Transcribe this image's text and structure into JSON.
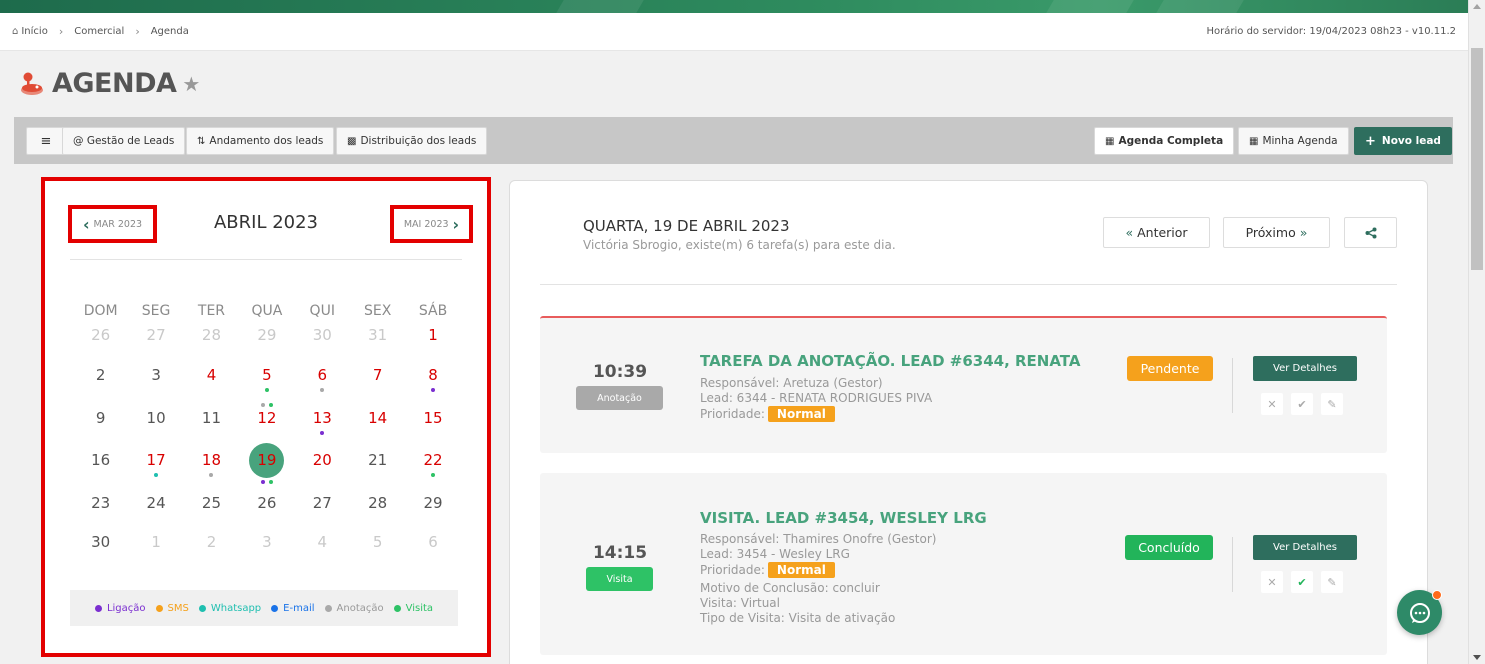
{
  "breadcrumb": {
    "home": "Início",
    "commercial": "Comercial",
    "agenda": "Agenda"
  },
  "server_time": "Horário do servidor: 19/04/2023 08h23 - v10.11.2",
  "page": {
    "title": "AGENDA"
  },
  "toolbar": {
    "leads_management": "@ Gestão de Leads",
    "leads_progress": "Andamento dos leads",
    "leads_distribution": "Distribuição dos leads",
    "full_agenda": "Agenda Completa",
    "my_agenda": "Minha Agenda",
    "new_lead": "Novo lead"
  },
  "calendar": {
    "prev": "MAR 2023",
    "next": "MAI 2023",
    "month": "ABRIL 2023",
    "weekdays": [
      "DOM",
      "SEG",
      "TER",
      "QUA",
      "QUI",
      "SEX",
      "SÁB"
    ],
    "weeks": [
      [
        {
          "d": "26",
          "t": "muted"
        },
        {
          "d": "27",
          "t": "muted"
        },
        {
          "d": "28",
          "t": "muted"
        },
        {
          "d": "29",
          "t": "muted"
        },
        {
          "d": "30",
          "t": "muted"
        },
        {
          "d": "31",
          "t": "muted"
        },
        {
          "d": "1",
          "t": "red"
        }
      ],
      [
        {
          "d": "2",
          "t": ""
        },
        {
          "d": "3",
          "t": ""
        },
        {
          "d": "4",
          "t": "red"
        },
        {
          "d": "5",
          "t": "red",
          "dots": [
            "visita"
          ]
        },
        {
          "d": "6",
          "t": "red",
          "dots": [
            "anotacao"
          ]
        },
        {
          "d": "7",
          "t": "red"
        },
        {
          "d": "8",
          "t": "red",
          "dots": [
            "ligacao"
          ]
        }
      ],
      [
        {
          "d": "9",
          "t": ""
        },
        {
          "d": "10",
          "t": ""
        },
        {
          "d": "11",
          "t": ""
        },
        {
          "d": "12",
          "t": "red",
          "dots": [
            "anotacao",
            "visita"
          ]
        },
        {
          "d": "13",
          "t": "red",
          "dots": [
            "ligacao"
          ]
        },
        {
          "d": "14",
          "t": "red"
        },
        {
          "d": "15",
          "t": "red"
        }
      ],
      [
        {
          "d": "16",
          "t": ""
        },
        {
          "d": "17",
          "t": "red",
          "dots": [
            "whatsapp"
          ]
        },
        {
          "d": "18",
          "t": "red",
          "dots": [
            "anotacao"
          ]
        },
        {
          "d": "19",
          "t": "today",
          "dots": [
            "ligacao",
            "visita"
          ]
        },
        {
          "d": "20",
          "t": "red"
        },
        {
          "d": "21",
          "t": ""
        },
        {
          "d": "22",
          "t": "red",
          "dots": [
            "visita"
          ]
        }
      ],
      [
        {
          "d": "23",
          "t": ""
        },
        {
          "d": "24",
          "t": ""
        },
        {
          "d": "25",
          "t": ""
        },
        {
          "d": "26",
          "t": ""
        },
        {
          "d": "27",
          "t": ""
        },
        {
          "d": "28",
          "t": ""
        },
        {
          "d": "29",
          "t": ""
        }
      ],
      [
        {
          "d": "30",
          "t": ""
        },
        {
          "d": "1",
          "t": "muted"
        },
        {
          "d": "2",
          "t": "muted"
        },
        {
          "d": "3",
          "t": "muted"
        },
        {
          "d": "4",
          "t": "muted"
        },
        {
          "d": "5",
          "t": "muted"
        },
        {
          "d": "6",
          "t": "muted"
        }
      ]
    ],
    "legend": [
      {
        "label": "Ligação",
        "key": "ligacao",
        "color": "#7b2fd0"
      },
      {
        "label": "SMS",
        "key": "sms",
        "color": "#f5a11c"
      },
      {
        "label": "Whatsapp",
        "key": "whatsapp",
        "color": "#1fbfb0"
      },
      {
        "label": "E-mail",
        "key": "email",
        "color": "#1a73e8"
      },
      {
        "label": "Anotação",
        "key": "anotacao",
        "color": "#a9a9a9"
      },
      {
        "label": "Visita",
        "key": "visita",
        "color": "#2ec266"
      }
    ]
  },
  "day_view": {
    "title": "QUARTA, 19 DE ABRIL 2023",
    "subtitle": "Victória Sbrogio, existe(m) 6 tarefa(s) para este dia.",
    "prev_label": "Anterior",
    "next_label": "Próximo"
  },
  "tasks": [
    {
      "time": "10:39",
      "type": "Anotação",
      "type_color": "#a9a9a9",
      "title": "TAREFA DA ANOTAÇÃO. LEAD #6344, RENATA",
      "lines": [
        "Responsável: Aretuza (Gestor)",
        "Lead: 6344 - RENATA RODRIGUES PIVA"
      ],
      "priority_label": "Prioridade:",
      "priority": "Normal",
      "status": "Pendente",
      "status_color": "#f5a11c",
      "details": "Ver Detalhes"
    },
    {
      "time": "14:15",
      "type": "Visita",
      "type_color": "#2ec266",
      "title": "VISITA. LEAD #3454, WESLEY LRG",
      "lines": [
        "Responsável: Thamires Onofre (Gestor)",
        "Lead: 3454 - Wesley LRG"
      ],
      "priority_label": "Prioridade:",
      "priority": "Normal",
      "extra_lines": [
        "Motivo de Conclusão: concluir",
        "Visita: Virtual",
        "Tipo de Visita: Visita de ativação"
      ],
      "status": "Concluído",
      "status_color": "#22b45a",
      "details": "Ver Detalhes"
    }
  ]
}
